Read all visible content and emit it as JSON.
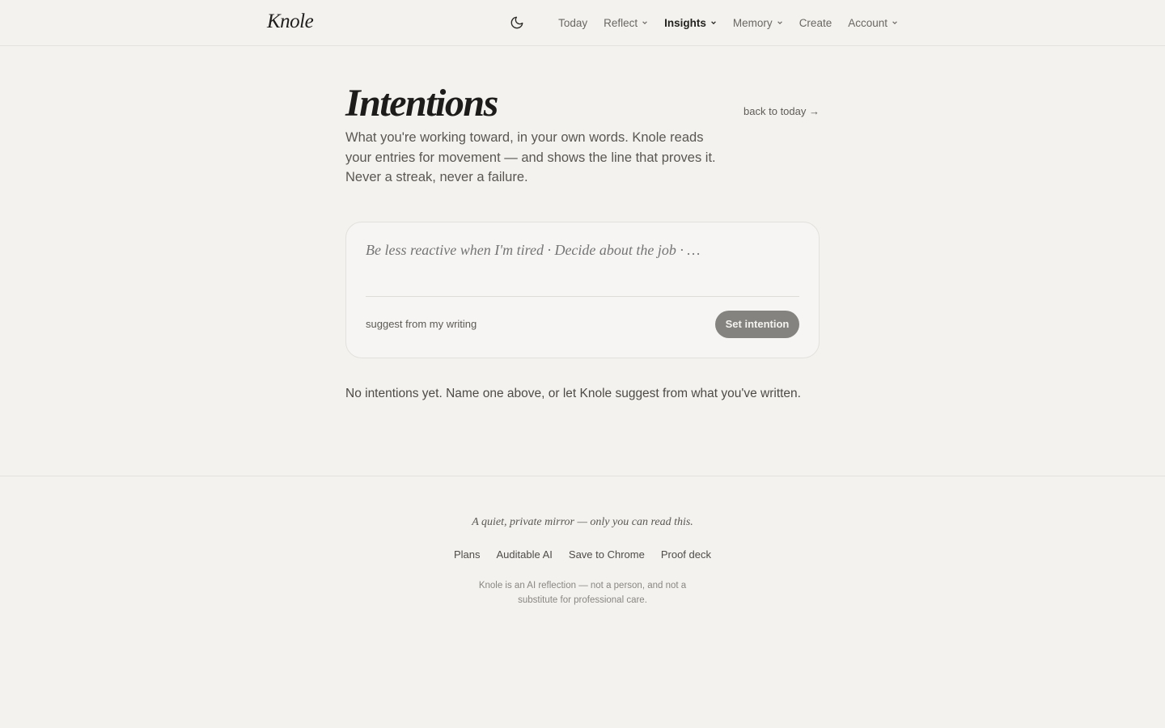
{
  "header": {
    "brand": "Knole",
    "nav": [
      {
        "label": "Today",
        "dropdown": false
      },
      {
        "label": "Reflect",
        "dropdown": true
      },
      {
        "label": "Insights",
        "dropdown": true,
        "active": true
      },
      {
        "label": "Memory",
        "dropdown": true
      },
      {
        "label": "Create",
        "dropdown": false
      },
      {
        "label": "Account",
        "dropdown": true
      }
    ],
    "theme_icon": "moon-icon"
  },
  "page": {
    "title": "Intentions",
    "back_link": "back to today →",
    "lede": "What you're working toward, in your own words. Knole reads your entries for movement — and shows the line that proves it. Never a streak, never a failure.",
    "input_placeholder": "Be less reactive when I'm tired · Decide about the job · …",
    "input_value": "",
    "suggest_label": "suggest from my writing",
    "submit_label": "Set intention",
    "empty_state": "No intentions yet. Name one above, or let Knole suggest from what you've written."
  },
  "footer": {
    "tagline": "A quiet, private mirror — only you can read this.",
    "links": [
      "Plans",
      "Auditable AI",
      "Save to Chrome",
      "Proof deck"
    ],
    "disclaimer": "Knole is an AI reflection — not a person, and not a substitute for professional care."
  },
  "colors": {
    "background": "#f3f2ef",
    "button": "#85837f",
    "text": "#3a3835"
  }
}
